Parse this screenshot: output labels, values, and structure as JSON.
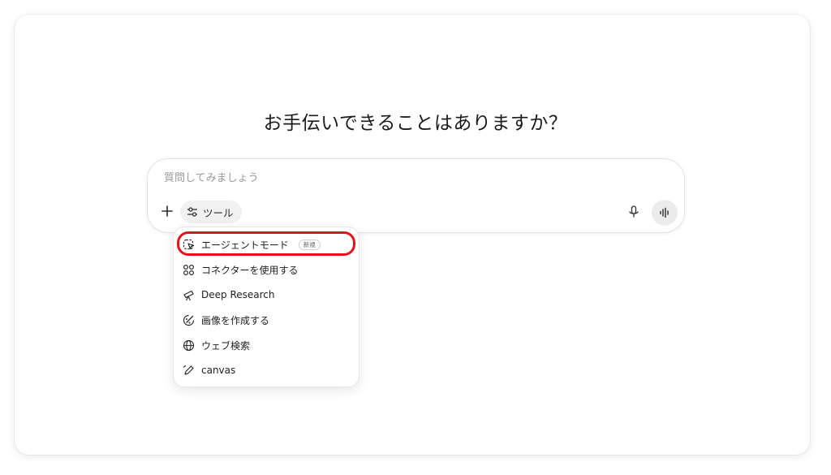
{
  "headline": "お手伝いできることはありますか？",
  "composer": {
    "placeholder": "質問してみましょう",
    "tools_label": "ツール"
  },
  "icons": {
    "plus": "plus-icon",
    "tools": "sliders-icon",
    "mic": "microphone-icon",
    "voice": "voice-waveform-icon"
  },
  "menu": {
    "items": [
      {
        "label": "エージェントモード",
        "badge": "新規",
        "icon": "agent-cursor-icon"
      },
      {
        "label": "コネクターを使用する",
        "icon": "connectors-icon"
      },
      {
        "label": "Deep Research",
        "icon": "telescope-icon"
      },
      {
        "label": "画像を作成する",
        "icon": "image-create-icon"
      },
      {
        "label": "ウェブ検索",
        "icon": "globe-icon"
      },
      {
        "label": "canvas",
        "icon": "pen-icon"
      }
    ]
  },
  "colors": {
    "highlight": "#e3141b",
    "tools_bg": "#f1f1f1",
    "voice_bg": "#ececec"
  }
}
